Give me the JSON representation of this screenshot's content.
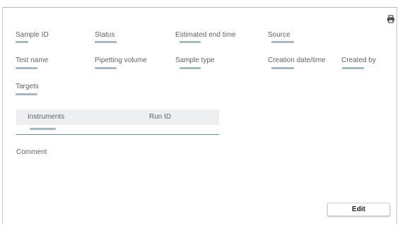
{
  "header": {
    "print_icon": "printer-icon"
  },
  "fields_row1": [
    {
      "label": "Sample ID"
    },
    {
      "label": "Status"
    },
    {
      "label": "Estimated end time"
    },
    {
      "label": "Source"
    }
  ],
  "fields_row2": [
    {
      "label": "Test name"
    },
    {
      "label": "Pipetting volume"
    },
    {
      "label": "Sample type"
    },
    {
      "label": "Creation date/time"
    },
    {
      "label": "Created by"
    }
  ],
  "fields_row3": [
    {
      "label": "Targets"
    }
  ],
  "table": {
    "columns": [
      "Instruments",
      "Run ID"
    ]
  },
  "comment": {
    "label": "Comment"
  },
  "actions": {
    "edit_label": "Edit"
  },
  "colors": {
    "placeholder": "#a9b8bd",
    "table_header_bg": "#eeeff0",
    "table_rule": "#6f8a8f",
    "label_text": "#5f6468"
  }
}
